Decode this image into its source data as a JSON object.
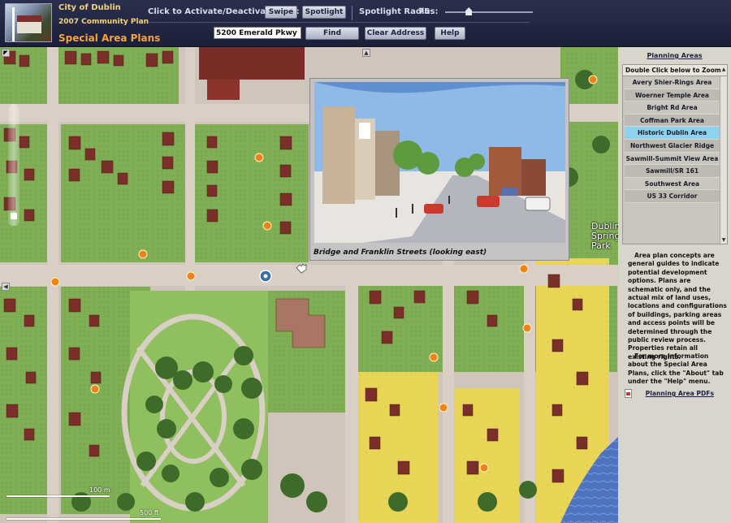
{
  "header": {
    "org_name": "City of Dublin",
    "plan_name": "2007 Community Plan",
    "app_title": "Special Area Plans",
    "tool_label": "Click to Activate/Deactivate Tool:",
    "swipe_label": "Swipe",
    "spotlight_label": "Spotlight",
    "radius_label": "Spotlight Radius:",
    "radius_value": "75",
    "radius_level": 0.27,
    "address_value": "5200 Emerald Pkwy",
    "find_label": "Find Address",
    "clear_label": "Clear Address",
    "help_label": "Help"
  },
  "map": {
    "popup_caption": "Bridge and Franklin Streets (looking east)",
    "park_label_lines": [
      "Dublin",
      "Spring",
      "Park"
    ],
    "scale_metric": "100 m",
    "scale_imperial": "500 ft"
  },
  "sidebar": {
    "title": "Planning Areas",
    "list_header": "Double Click below to Zoom",
    "items": [
      {
        "label": "Avery Shier-Rings Area"
      },
      {
        "label": "Woerner Temple Area"
      },
      {
        "label": "Bright Rd Area"
      },
      {
        "label": "Coffman Park Area"
      },
      {
        "label": "Historic Dublin Area",
        "selected": true
      },
      {
        "label": "Northwest Glacier Ridge"
      },
      {
        "label": "Sawmill-Summit View Area"
      },
      {
        "label": "Sawmill/SR 161"
      },
      {
        "label": "Southwest Area"
      },
      {
        "label": "US 33 Corridor"
      }
    ],
    "notice": "Area plan concepts are general guides to indicate potential development options. Plans are schematic only, and the actual mix of land uses, locations and configurations of buildings, parking areas and access points will be determined through the public review process. Properties retain all existing rights.",
    "more_info": "For more information about the Special Area Plans, click the \"About\" tab under the \"Help\" menu.",
    "pdf_link": "Planning Area PDFs"
  },
  "colors": {
    "header_bg": "#1f2340",
    "title_orange": "#f6a33c",
    "selected_item": "#8fd2ef",
    "sidebar_bg": "#d7d5cc"
  }
}
